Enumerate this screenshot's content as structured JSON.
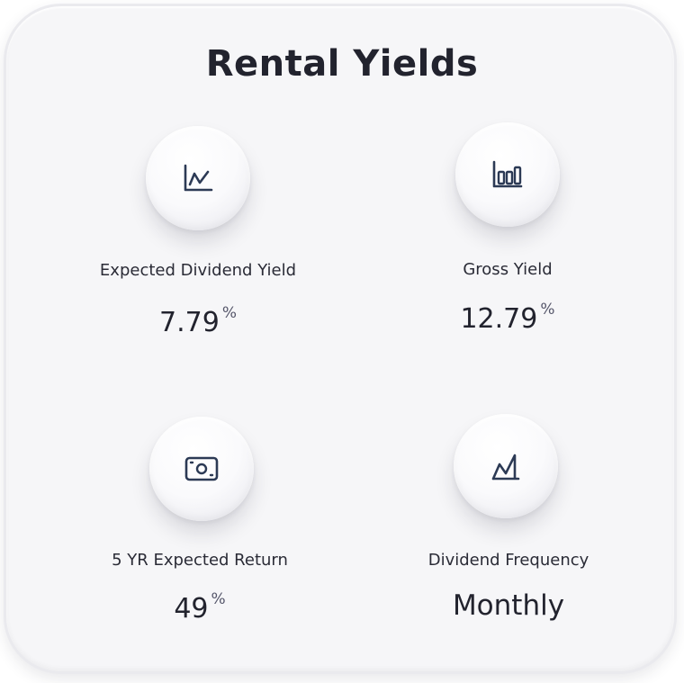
{
  "card": {
    "title": "Rental Yields"
  },
  "metrics": [
    {
      "icon": "line-chart-icon",
      "label": "Expected Dividend Yield",
      "value": "7.79",
      "unit": "%"
    },
    {
      "icon": "bar-chart-icon",
      "label": "Gross Yield",
      "value": "12.79",
      "unit": "%"
    },
    {
      "icon": "cash-icon",
      "label": "5 YR Expected Return",
      "value": "49",
      "unit": "%"
    },
    {
      "icon": "trend-chart-icon",
      "label": "Dividend Frequency",
      "value": "Monthly"
    }
  ],
  "colors": {
    "background": "#f6f6f8",
    "text": "#22232e",
    "icon": "#2c3a55"
  }
}
